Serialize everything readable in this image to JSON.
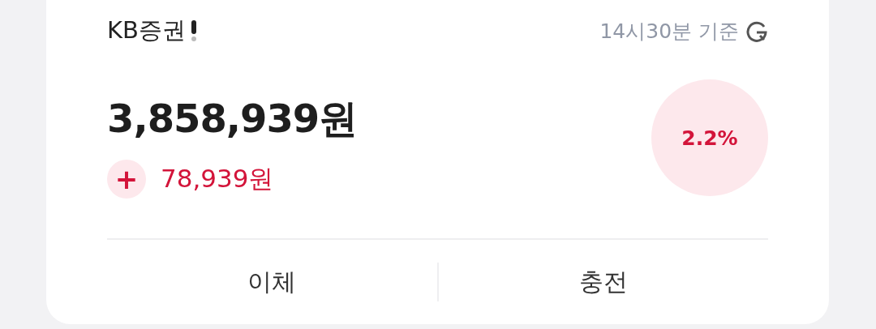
{
  "account": {
    "name": "KB증권",
    "timestamp": "14시30분 기준",
    "balance": "3,858,939원",
    "change": {
      "sign": "+",
      "amount": "78,939원"
    },
    "rate": "2.2%"
  },
  "actions": [
    {
      "label": "이체"
    },
    {
      "label": "충전"
    }
  ]
}
